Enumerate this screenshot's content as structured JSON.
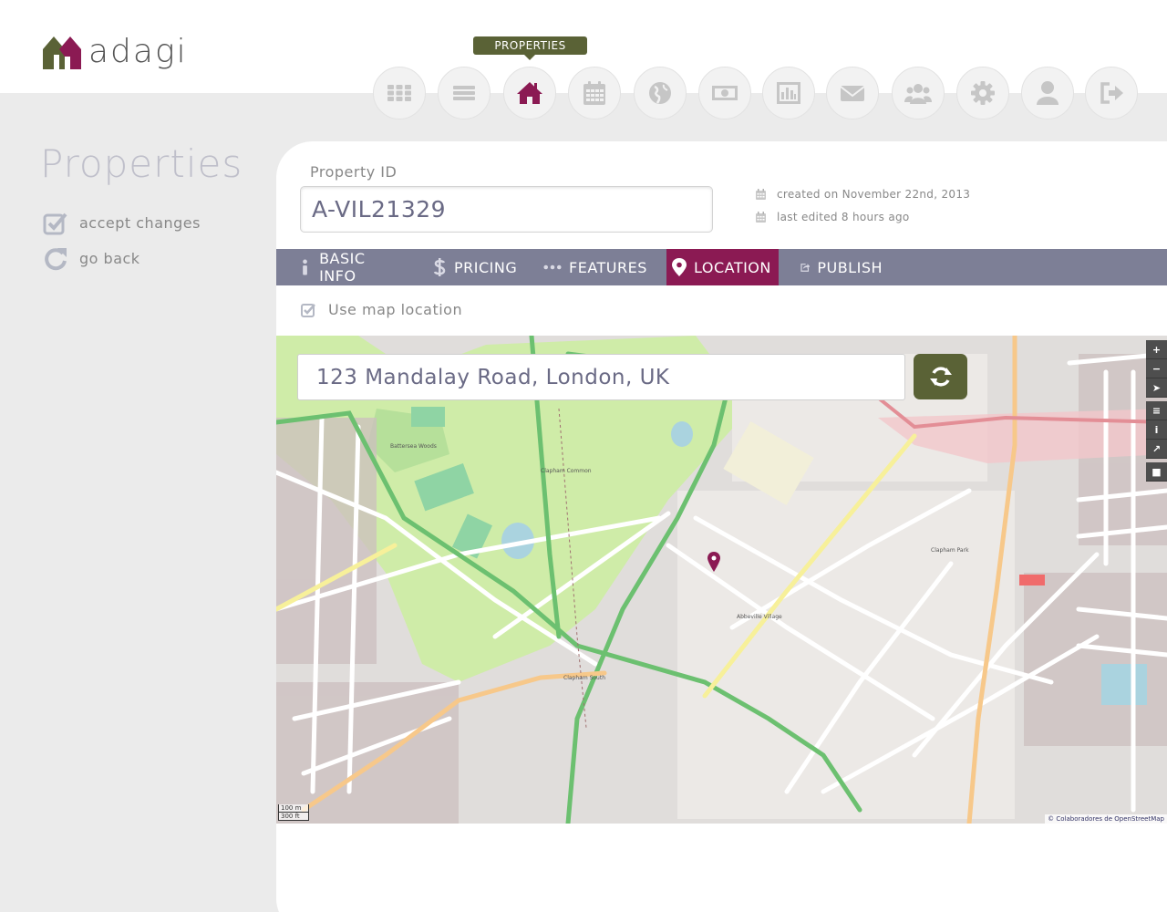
{
  "app": {
    "logo_text": "adagi"
  },
  "nav": {
    "tooltip": "PROPERTIES",
    "items": [
      {
        "icon": "dashboard-grid-icon",
        "active": false
      },
      {
        "icon": "list-icon",
        "active": false
      },
      {
        "icon": "home-icon",
        "active": true
      },
      {
        "icon": "calendar-icon",
        "active": false
      },
      {
        "icon": "globe-icon",
        "active": false
      },
      {
        "icon": "money-icon",
        "active": false
      },
      {
        "icon": "bar-chart-icon",
        "active": false
      },
      {
        "icon": "envelope-icon",
        "active": false
      },
      {
        "icon": "users-icon",
        "active": false
      },
      {
        "icon": "gear-icon",
        "active": false
      },
      {
        "icon": "user-icon",
        "active": false
      },
      {
        "icon": "sign-out-icon",
        "active": false
      }
    ]
  },
  "sidebar": {
    "title": "Properties",
    "actions": [
      {
        "label": "accept changes",
        "icon": "check-square-icon"
      },
      {
        "label": "go back",
        "icon": "undo-arrow-icon"
      }
    ]
  },
  "form": {
    "id_label": "Property ID",
    "id_value": "A-VIL21329",
    "created": "created on November 22nd, 2013",
    "edited": "last edited 8 hours ago"
  },
  "tabs": [
    {
      "label": "BASIC INFO",
      "icon": "info-icon",
      "active": false
    },
    {
      "label": "PRICING",
      "icon": "dollar-icon",
      "active": false
    },
    {
      "label": "FEATURES",
      "icon": "ellipsis-icon",
      "active": false
    },
    {
      "label": "LOCATION",
      "icon": "map-marker-icon",
      "active": true
    },
    {
      "label": "PUBLISH",
      "icon": "share-icon",
      "active": false
    }
  ],
  "location": {
    "use_map_label": "Use map location",
    "use_map_checked": true,
    "address_value": "123 Mandalay Road, London, UK",
    "map_controls": [
      "+",
      "−",
      "➤",
      "≡",
      "i",
      "↗",
      "■"
    ],
    "scale_m": "100 m",
    "scale_ft": "300 ft",
    "attribution": "© Colaboradores de OpenStreetMap"
  },
  "colors": {
    "accent": "#8b1a53",
    "olive": "#5a6236",
    "tabbar": "#7d7f96"
  }
}
